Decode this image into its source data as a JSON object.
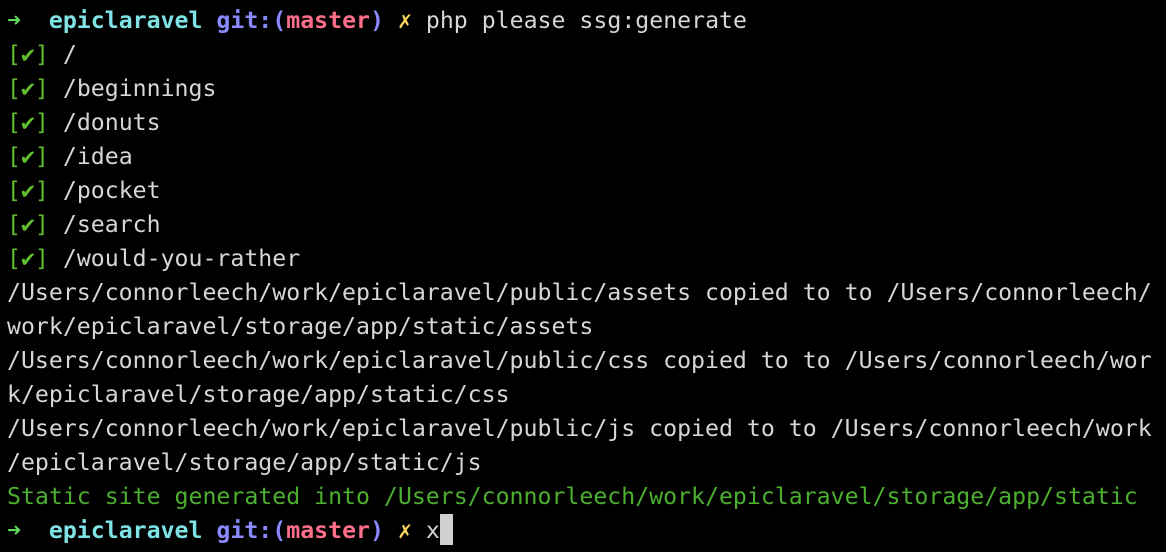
{
  "prompt": {
    "arrow": "➜",
    "directory": "epiclaravel",
    "git_prefix": "git:(",
    "branch": "master",
    "git_suffix": ")",
    "dirty_marker": "✗"
  },
  "command": "php please ssg:generate",
  "routes": [
    {
      "check": "[✔]",
      "path": "/"
    },
    {
      "check": "[✔]",
      "path": "/beginnings"
    },
    {
      "check": "[✔]",
      "path": "/donuts"
    },
    {
      "check": "[✔]",
      "path": "/idea"
    },
    {
      "check": "[✔]",
      "path": "/pocket"
    },
    {
      "check": "[✔]",
      "path": "/search"
    },
    {
      "check": "[✔]",
      "path": "/would-you-rather"
    }
  ],
  "output_lines": [
    "/Users/connorleech/work/epiclaravel/public/assets copied to to /Users/connorleech/",
    "work/epiclaravel/storage/app/static/assets",
    "/Users/connorleech/work/epiclaravel/public/css copied to to /Users/connorleech/wor",
    "k/epiclaravel/storage/app/static/css",
    "/Users/connorleech/work/epiclaravel/public/js copied to to /Users/connorleech/work",
    "/epiclaravel/storage/app/static/js"
  ],
  "success_message": "Static site generated into /Users/connorleech/work/epiclaravel/storage/app/static",
  "current_input": "x",
  "colors": {
    "background": "#000000",
    "directory": "#7fe3e6",
    "git": "#8a8aff",
    "branch": "#ff6f8a",
    "dirty": "#ffd75f",
    "success": "#4caf2f"
  }
}
